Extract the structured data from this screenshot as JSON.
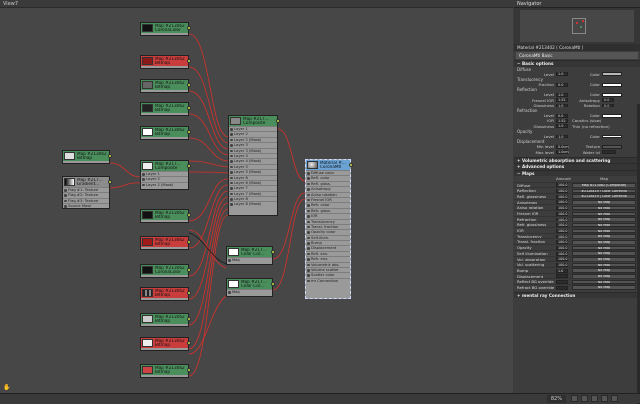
{
  "view": {
    "title": "View7",
    "zoom": "82%"
  },
  "navigator": {
    "title": "Navigator"
  },
  "nodes": {
    "corona_color_a": {
      "line1": "Map #213062",
      "line2": "CoronaColor"
    },
    "bitmap_a": {
      "line1": "Map #213062",
      "line2": "Bitmap"
    },
    "bitmap_b": {
      "line1": "Map #213062",
      "line2": "Bitmap"
    },
    "bitmap_c": {
      "line1": "Map #213062",
      "line2": "Bitmap"
    },
    "bitmap_d": {
      "line1": "Map #213062",
      "line2": "Bitmap"
    },
    "bitmap_e": {
      "line1": "Map #213062",
      "line2": "Bitmap"
    },
    "composite_mid": {
      "line1": "Map #217...",
      "line2": "Composite"
    },
    "bitmap_left": {
      "line1": "Map #213062",
      "line2": "Bitmap"
    },
    "gradient_left": {
      "line1": "Map #217...",
      "line2": "Gradient..."
    },
    "bitmap_f": {
      "line1": "Map #213062",
      "line2": "Bitmap"
    },
    "bitmap_g": {
      "line1": "Map #213062",
      "line2": "Bitmap"
    },
    "corona_color_b": {
      "line1": "Map #213062",
      "line2": "CoronaColor"
    },
    "bitmap_h": {
      "line1": "Map #213062",
      "line2": "Bitmap"
    },
    "bitmap_i": {
      "line1": "Map #213062",
      "line2": "Bitmap"
    },
    "bitmap_j": {
      "line1": "Map #213062",
      "line2": "Bitmap"
    },
    "bitmap_k": {
      "line1": "Map #213062",
      "line2": "Bitmap"
    },
    "composite_big": {
      "line1": "Map #217...",
      "line2": "Composite"
    },
    "color_corr_a": {
      "line1": "Map #217...",
      "line2": "Color Cor..."
    },
    "color_corr_b": {
      "line1": "Map #217...",
      "line2": "Color Cor..."
    },
    "material": {
      "line1": "Material #...",
      "line2": "CoronaMtl"
    }
  },
  "slots": {
    "composite_mid": [
      "Layer 1",
      "Layer 2",
      "Layer 2 (Mask)"
    ],
    "gradient_left": [
      "Flag #1: Texture",
      "Flag #2: Texture",
      "Flag #3: Texture",
      "Source Mask"
    ],
    "composite_big": [
      "Layer 1",
      "Layer 2",
      "Layer 2 (Mask)",
      "Layer 3",
      "Layer 3 (Mask)",
      "Layer 4",
      "Layer 4 (Mask)",
      "Layer 5",
      "Layer 5 (Mask)",
      "Layer 6",
      "Layer 6 (Mask)",
      "Layer 7",
      "Layer 7 (Mask)",
      "Layer 8",
      "Layer 8 (Mask)"
    ],
    "color_corr_a": [
      "Map"
    ],
    "color_corr_b": [
      "Map"
    ],
    "material": [
      "Diffuse color",
      "Refl. color",
      "Refl. gloss.",
      "Anisotropy",
      "Aniso rotation",
      "Fresnel IOR",
      "Refr. color",
      "Refr. gloss.",
      "IOR",
      "Translucency",
      "Transl. fraction",
      "Opacity color",
      "Self-illum.",
      "Bump",
      "Displacement",
      "Refl. env.",
      "Refr. env.",
      "Volumetric abs.",
      "Volume scatter",
      "Scatter color",
      "mr Connection"
    ]
  },
  "panel": {
    "title": "Material #213402  ( CoronaMtl )",
    "name": "CoronaMtl Basic",
    "basic_options": "Basic options",
    "diffuse": {
      "label": "Diffuse",
      "level_label": "Level",
      "level": "1.0",
      "color_label": "Color",
      "color": "#b8b8b8",
      "translucency": "Translucency",
      "fraction_label": "Fraction",
      "fraction": "0.0"
    },
    "reflection": {
      "label": "Reflection",
      "level": "1.0",
      "fresnel_label": "Fresnel IOR",
      "fresnel": "1.52",
      "aniso_label": "Anisotropy",
      "aniso": "0.0",
      "gloss_label": "Glossiness",
      "gloss": "1.0",
      "rot_label": "Rotation",
      "rot": "0.0",
      "deg": "deg"
    },
    "refraction": {
      "label": "Refraction",
      "level": "0.0",
      "ior_label": "IOR",
      "ior": "1.52",
      "caustics": "Caustics (slow)",
      "gloss": "1.0",
      "thin": "Thin (no refraction)"
    },
    "opacity": {
      "label": "Opacity",
      "level": "1.0",
      "color_label": "Color",
      "clip": "Clip"
    },
    "displacement": {
      "label": "Displacement",
      "min_label": "Min level",
      "min": "0.0cm",
      "texture_label": "Texture",
      "max_label": "Max level",
      "max": "1.0cm",
      "water_label": "Water lvl"
    },
    "rollups": [
      "Volumetric absorption and scattering",
      "Advanced options",
      "Maps"
    ],
    "maps_headers": {
      "amount": "Amount",
      "map": "Map"
    },
    "maps": [
      {
        "name": "Diffuse",
        "amount": "100.0",
        "map": "Map #213062 (Composite)"
      },
      {
        "name": "Reflection",
        "amount": "100.0",
        "map": "#2128419 ( Color Correctio"
      },
      {
        "name": "Refl. glossiness",
        "amount": "100.0",
        "map": "#2128419 ( Color Correctio"
      },
      {
        "name": "Anisotropy",
        "amount": "100.0",
        "map": "No Map"
      },
      {
        "name": "Aniso rotation",
        "amount": "100.0",
        "map": "No Map"
      },
      {
        "name": "Fresnel IOR",
        "amount": "100.0",
        "map": "No Map"
      },
      {
        "name": "Refraction",
        "amount": "100.0",
        "map": "No Map"
      },
      {
        "name": "Refr. glossiness",
        "amount": "100.0",
        "map": "No Map"
      },
      {
        "name": "IOR",
        "amount": "100.0",
        "map": "No Map"
      },
      {
        "name": "Translucency",
        "amount": "100.0",
        "map": "No Map"
      },
      {
        "name": "Transl. fraction",
        "amount": "100.0",
        "map": "No Map"
      },
      {
        "name": "Opacity",
        "amount": "100.0",
        "map": "No Map"
      },
      {
        "name": "Self illumination",
        "amount": "100.0",
        "map": "No Map"
      },
      {
        "name": "Vol. absorption",
        "amount": "100.0",
        "map": "No Map"
      },
      {
        "name": "Vol. scattering",
        "amount": "100.0",
        "map": "No Map"
      },
      {
        "name": "Bump",
        "amount": "1.0",
        "map": "No Map"
      },
      {
        "name": "Displacement",
        "amount": "",
        "map": "No Map"
      },
      {
        "name": "Reflect BG override",
        "amount": "",
        "map": "No Map"
      },
      {
        "name": "Refract BG override",
        "amount": "",
        "map": "No Map"
      }
    ],
    "mental_ray": "mental ray Connection"
  }
}
